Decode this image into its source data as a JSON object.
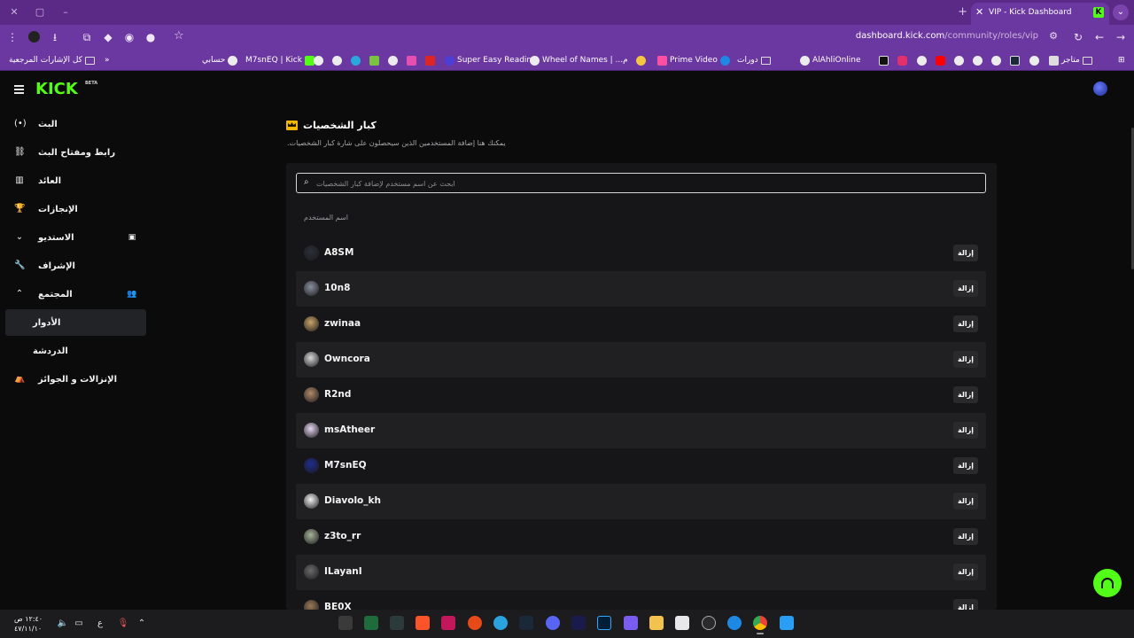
{
  "browser": {
    "tab": {
      "title": "VIP - Kick Dashboard",
      "favicon": "K"
    },
    "url": {
      "host": "dashboard.kick.com",
      "path": "/community/roles/vip"
    },
    "bookmarks": [
      "كل الإشارات المرجعية",
      "حسابي",
      "M7snEQ | Kick",
      "Super Easy Reading",
      "Wheel of Names | ...م",
      "Prime Video",
      "دورات",
      "AlAhliOnline",
      "متاجر"
    ]
  },
  "app": {
    "logo": "KICK",
    "logo_badge": "BETA",
    "sidebar": [
      {
        "label": "البث",
        "icon": "broadcast-icon"
      },
      {
        "label": "رابط ومفتاح البث",
        "icon": "link-icon"
      },
      {
        "label": "العائد",
        "icon": "revenue-icon"
      },
      {
        "label": "الإنجازات",
        "icon": "trophy-icon"
      },
      {
        "label": "الاستديو",
        "icon": "chevron-down-icon"
      },
      {
        "label": "الإشراف",
        "icon": "wrench-icon"
      },
      {
        "label": "المجتمع",
        "icon": "chevron-up-icon"
      },
      {
        "label": "الأدوار",
        "icon": ""
      },
      {
        "label": "الدردشة",
        "icon": ""
      },
      {
        "label": "الإنزالات و الجوائز",
        "icon": "gift-icon"
      }
    ],
    "page": {
      "title": "كبار الشخصيات",
      "subtitle": "يمكنك هنا إضافة المستخدمين الذين سيحصلون على شارة كبار الشخصيات.",
      "search_placeholder": "ابحث عن اسم مستخدم لإضافة كبار الشخصيات",
      "column_header": "اسم المستخدم",
      "remove_label": "إزالة",
      "users": [
        {
          "name": "A8SM",
          "avatar_color": "#2b2f3a"
        },
        {
          "name": "10n8",
          "avatar_color": "#8a8fa0"
        },
        {
          "name": "zwinaa",
          "avatar_color": "#c9a46a"
        },
        {
          "name": "Owncora",
          "avatar_color": "#d8d8d8"
        },
        {
          "name": "R2nd",
          "avatar_color": "#b08a6a"
        },
        {
          "name": "msAtheer",
          "avatar_color": "#e6d6f2"
        },
        {
          "name": "M7snEQ",
          "avatar_color": "#1f2d8f"
        },
        {
          "name": "Diavolo_kh",
          "avatar_color": "#f2f2f2"
        },
        {
          "name": "z3to_rr",
          "avatar_color": "#a7b39a"
        },
        {
          "name": "ILayanI",
          "avatar_color": "#6b6b6b"
        },
        {
          "name": "BE0X",
          "avatar_color": "#9a7a5a"
        }
      ]
    }
  },
  "taskbar": {
    "time": "١٢:٤٠ ص",
    "date": "٤٧/١١/١٠",
    "lang": "ع"
  }
}
